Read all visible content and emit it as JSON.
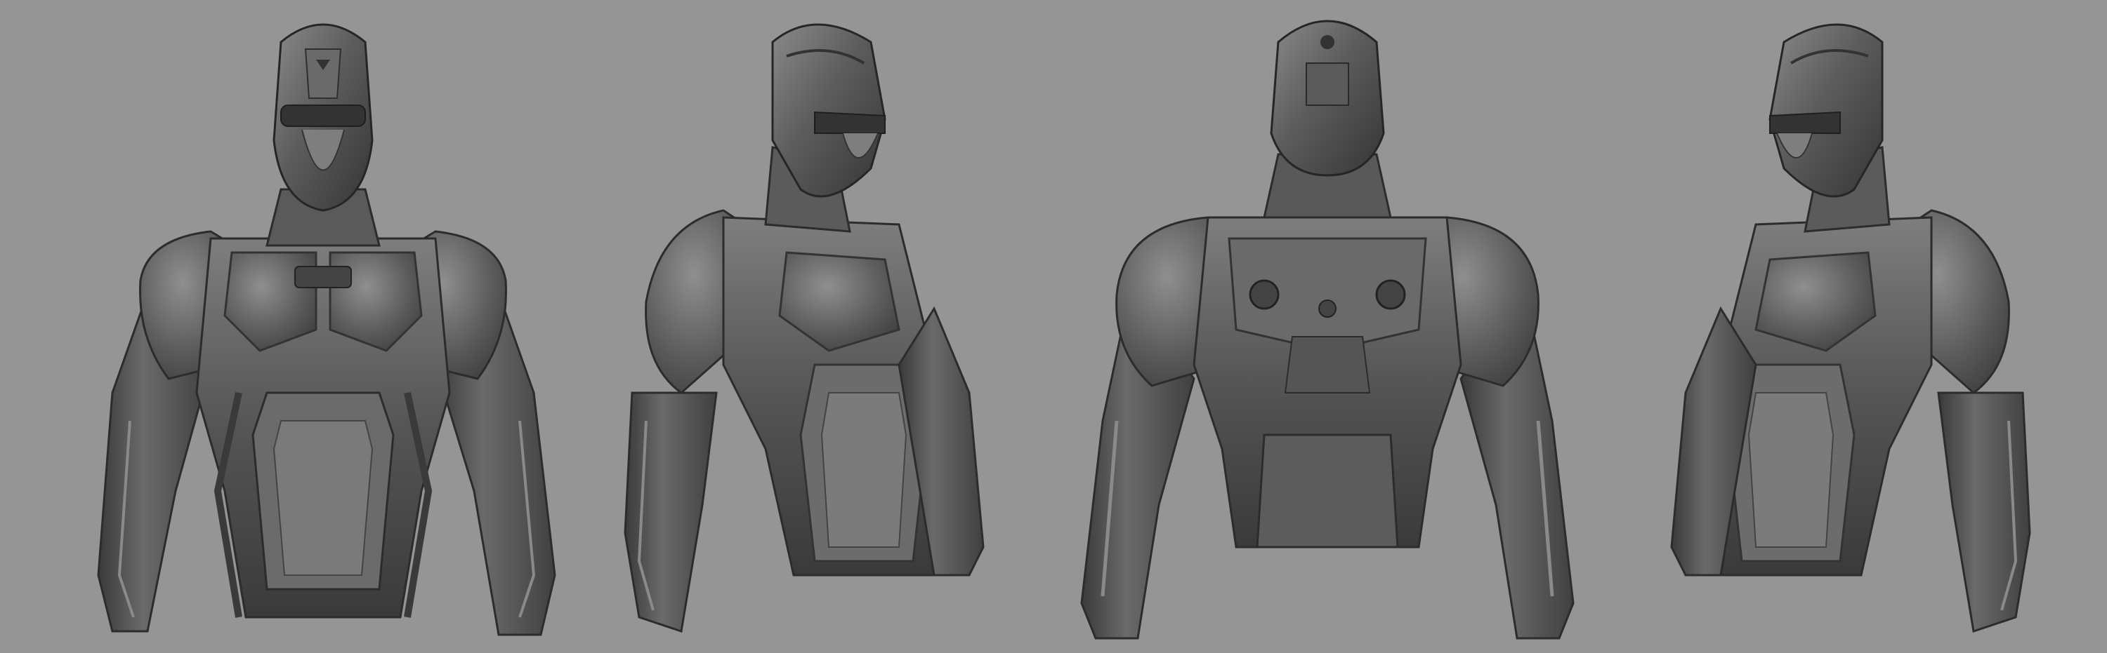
{
  "scene": {
    "background_color": "#959595",
    "material_colors": {
      "base": "#4e4e4e",
      "mid": "#5e5e5e",
      "light": "#7a7a7a",
      "highlight": "#9a9a9a",
      "shadow": "#2c2c2c"
    },
    "views": [
      {
        "id": "front"
      },
      {
        "id": "three-quarter-right"
      },
      {
        "id": "back"
      },
      {
        "id": "three-quarter-left"
      }
    ]
  }
}
